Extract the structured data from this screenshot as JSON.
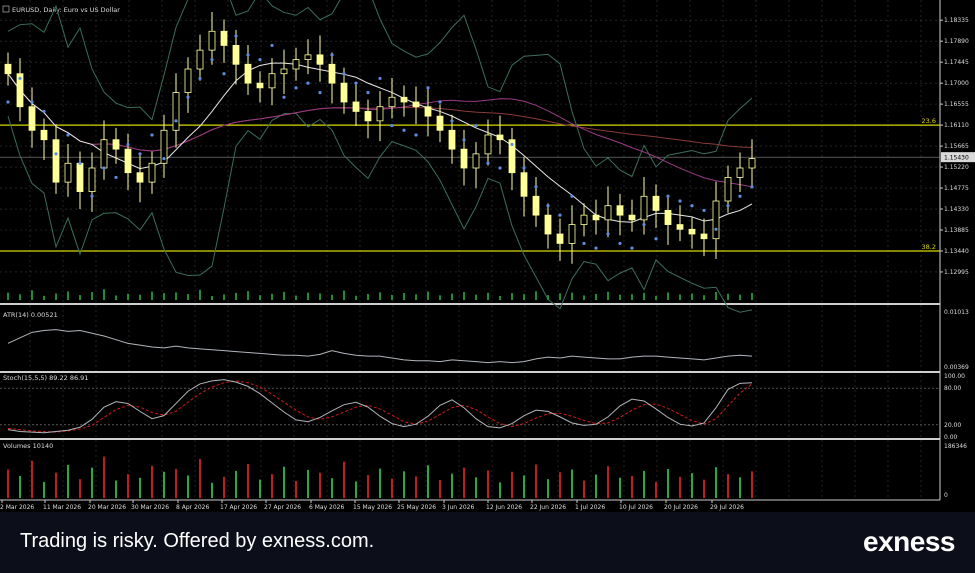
{
  "chart_data": {
    "type": "candlestick",
    "symbol_title": "EURUSD, Daily: Euro vs US Dollar",
    "colors": {
      "background": "#000000",
      "grid": "#3a3a3a",
      "candle": "#ffff99",
      "fib": "#d8d800",
      "ma_white": "#e8e8e8",
      "ma_purple": "#9a3a86",
      "ma_brown": "#8a3a3a",
      "bands": "#3c6e58",
      "psar": "#5a8ee0",
      "volume_green": "#1fae3f",
      "volume_red": "#c21b1b",
      "osc_line": "#b0b6bc",
      "stoch_signal": "#d11a1a"
    },
    "price_axis": {
      "min": 1.124,
      "max": 1.187,
      "ticks": [
        1.18335,
        1.1789,
        1.17445,
        1.17,
        1.16555,
        1.1611,
        1.15665,
        1.1522,
        1.14775,
        1.1433,
        1.13885,
        1.1344,
        1.12995
      ]
    },
    "current_price": 1.1543,
    "current_price_label": "1.15430",
    "fib_levels": [
      {
        "label": "23.6",
        "price": 1.1611
      },
      {
        "label": "38.2",
        "price": 1.1344
      }
    ],
    "x_labels": [
      "2 Mar 2026",
      "11 Mar 2026",
      "20 Mar 2026",
      "30 Mar 2026",
      "8 Apr 2026",
      "17 Apr 2026",
      "27 Apr 2026",
      "6 May 2026",
      "15 May 2026",
      "25 May 2026",
      "3 Jun 2026",
      "12 Jun 2026",
      "22 Jun 2026",
      "1 Jul 2026",
      "10 Jul 2026",
      "20 Jul 2026",
      "29 Jul 2026"
    ],
    "close_series": [
      1.172,
      1.165,
      1.16,
      1.158,
      1.149,
      1.153,
      1.147,
      1.152,
      1.158,
      1.156,
      1.151,
      1.149,
      1.153,
      1.16,
      1.168,
      1.173,
      1.177,
      1.181,
      1.178,
      1.174,
      1.17,
      1.169,
      1.172,
      1.173,
      1.175,
      1.176,
      1.174,
      1.17,
      1.166,
      1.164,
      1.162,
      1.165,
      1.167,
      1.166,
      1.165,
      1.163,
      1.16,
      1.156,
      1.152,
      1.155,
      1.159,
      1.158,
      1.151,
      1.146,
      1.142,
      1.138,
      1.136,
      1.14,
      1.142,
      1.141,
      1.144,
      1.142,
      1.141,
      1.146,
      1.143,
      1.14,
      1.139,
      1.138,
      1.137,
      1.145,
      1.15,
      1.152,
      1.154
    ],
    "atr": {
      "label": "ATR(14) 0.00521",
      "max_label": "0.01013",
      "min_label": "0.00369",
      "min": 0.00369,
      "max": 0.01013,
      "series": [
        0.0066,
        0.0072,
        0.0078,
        0.008,
        0.0081,
        0.0079,
        0.008,
        0.0077,
        0.0074,
        0.007,
        0.0066,
        0.0064,
        0.0062,
        0.0061,
        0.0063,
        0.0061,
        0.006,
        0.0059,
        0.0058,
        0.0057,
        0.0056,
        0.0055,
        0.0054,
        0.0053,
        0.0053,
        0.0052,
        0.0054,
        0.0058,
        0.0055,
        0.0053,
        0.0052,
        0.0052,
        0.005,
        0.0048,
        0.0047,
        0.0047,
        0.0046,
        0.0048,
        0.0047,
        0.0046,
        0.0045,
        0.0046,
        0.0045,
        0.0046,
        0.0049,
        0.0051,
        0.005,
        0.0052,
        0.0051,
        0.005,
        0.0049,
        0.0049,
        0.0051,
        0.0052,
        0.0052,
        0.0051,
        0.005,
        0.0049,
        0.0048,
        0.005,
        0.0052,
        0.0053,
        0.0052
      ]
    },
    "stoch": {
      "label": "Stoch(15,5,5) 89.22 86.91",
      "ticks": [
        "100.00",
        "80.00",
        "20.00",
        "0.00"
      ],
      "main": [
        12,
        9,
        8,
        7,
        9,
        11,
        16,
        29,
        49,
        58,
        55,
        42,
        30,
        35,
        55,
        75,
        87,
        92,
        94,
        90,
        83,
        71,
        56,
        41,
        28,
        25,
        32,
        43,
        53,
        57,
        49,
        34,
        22,
        17,
        21,
        34,
        52,
        61,
        48,
        30,
        17,
        15,
        22,
        35,
        44,
        42,
        33,
        23,
        19,
        21,
        33,
        51,
        62,
        59,
        46,
        32,
        21,
        18,
        23,
        48,
        78,
        88,
        89
      ],
      "signal": [
        14,
        12,
        10,
        9,
        8,
        10,
        13,
        19,
        32,
        45,
        52,
        49,
        40,
        36,
        42,
        57,
        71,
        82,
        89,
        92,
        89,
        82,
        70,
        57,
        44,
        33,
        29,
        33,
        41,
        49,
        52,
        46,
        36,
        25,
        21,
        26,
        37,
        48,
        52,
        45,
        33,
        22,
        17,
        22,
        31,
        38,
        39,
        34,
        27,
        22,
        23,
        32,
        44,
        53,
        54,
        47,
        37,
        27,
        21,
        30,
        51,
        72,
        87
      ]
    },
    "volume": {
      "label": "Volumes 10140",
      "max_label": "186346",
      "zero_label": "0",
      "bars": [
        62,
        48,
        81,
        35,
        55,
        72,
        41,
        66,
        90,
        38,
        52,
        44,
        70,
        57,
        63,
        49,
        85,
        33,
        46,
        59,
        74,
        40,
        52,
        68,
        37,
        61,
        55,
        43,
        79,
        36,
        50,
        64,
        42,
        58,
        47,
        71,
        39,
        53,
        66,
        45,
        60,
        34,
        57,
        49,
        73,
        41,
        56,
        62,
        38,
        51,
        69,
        44,
        48,
        59,
        35,
        63,
        46,
        54,
        40,
        67,
        52,
        45,
        58
      ]
    }
  },
  "footer": {
    "disclaimer": "Trading is risky. Offered by exness.com.",
    "brand": "exness"
  }
}
